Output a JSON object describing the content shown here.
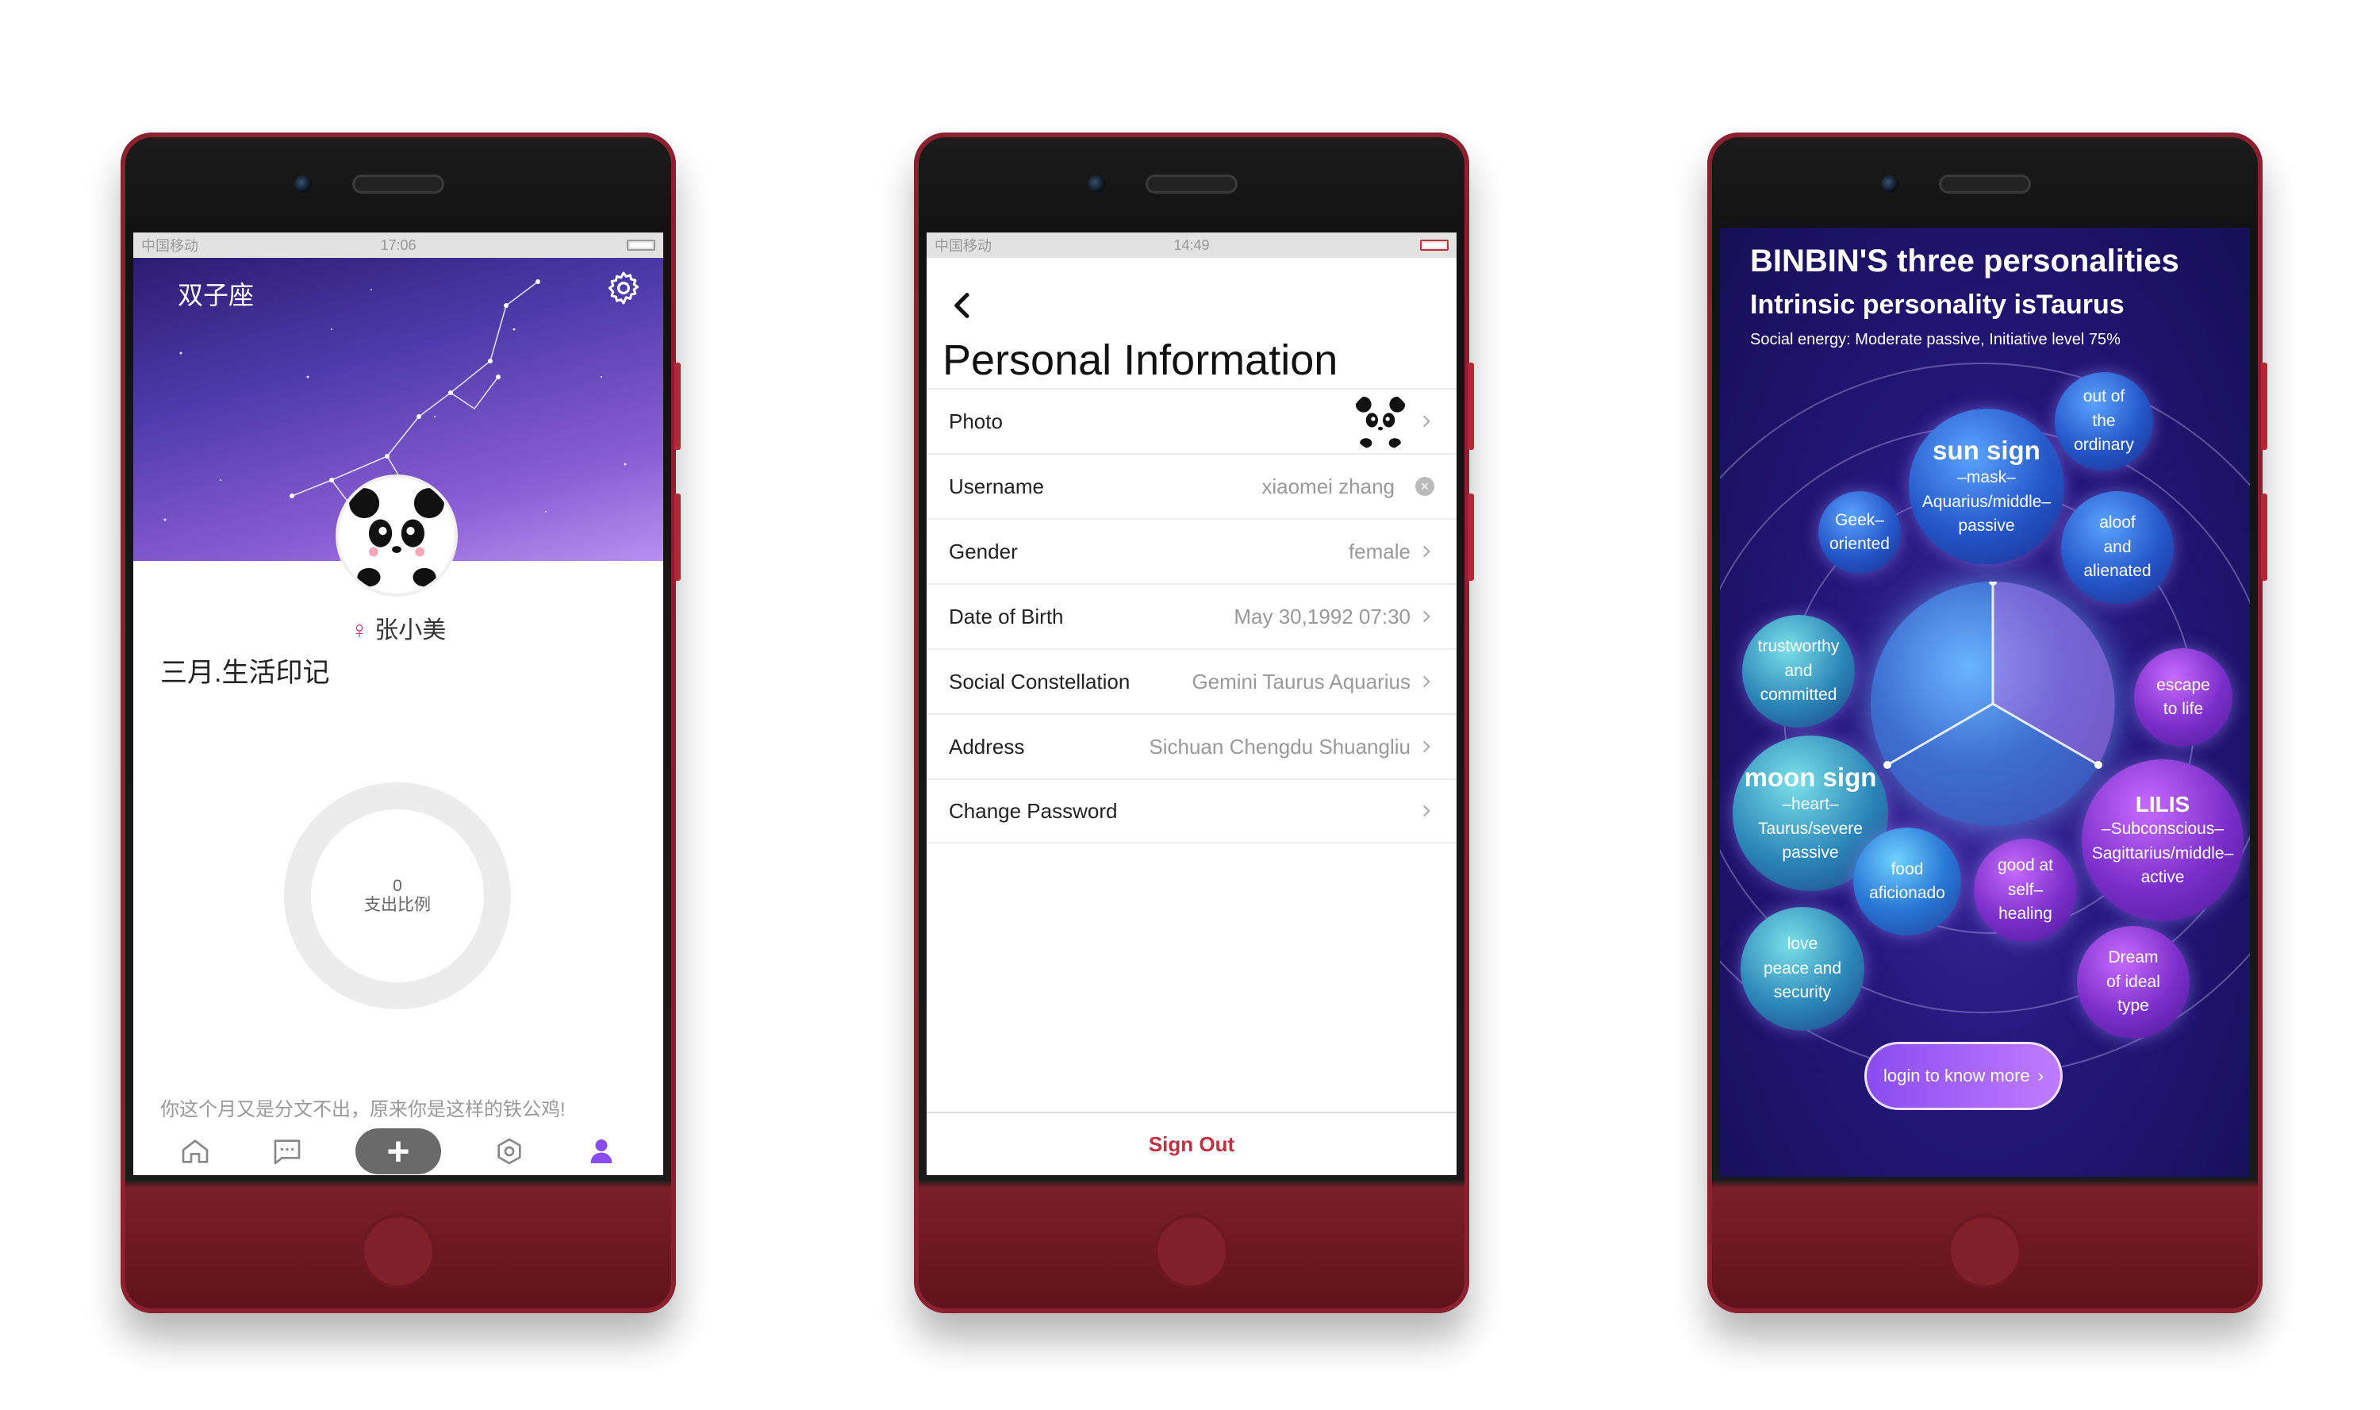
{
  "phone1": {
    "status": {
      "carrier": "中国移动",
      "time": "17:06"
    },
    "header_title": "双子座",
    "username": "张小美",
    "section_title": "三月.生活印记",
    "ring": {
      "value": "0",
      "label": "支出比例"
    },
    "tip": "你这个月又是分文不出，原来你是这样的铁公鸡!",
    "tabs": [
      "home-icon",
      "message-icon",
      "plus-icon",
      "hexagon-icon",
      "user-icon"
    ],
    "colors": {
      "accent": "#8a4cf0",
      "female": "#e0306f"
    }
  },
  "phone2": {
    "status": {
      "carrier": "中国移动",
      "time": "14:49"
    },
    "title": "Personal Information",
    "rows": [
      {
        "label": "Photo",
        "value": ""
      },
      {
        "label": "Username",
        "value": "xiaomei zhang"
      },
      {
        "label": "Gender",
        "value": "female"
      },
      {
        "label": "Date of Birth",
        "value": "May 30,1992 07:30"
      },
      {
        "label": "Social Constellation",
        "value": "Gemini Taurus Aquarius"
      },
      {
        "label": "Address",
        "value": "Sichuan Chengdu Shuangliu"
      },
      {
        "label": "Change Password",
        "value": ""
      }
    ],
    "sign_out": "Sign Out",
    "colors": {
      "sign_out": "#c03040"
    }
  },
  "phone3": {
    "title": "BINBIN'S three personalities",
    "subtitle": "Intrinsic personality isTaurus",
    "energy": "Social energy:   Moderate passive, Initiative level 75%",
    "sun": {
      "title": "sun sign",
      "lines": [
        "–mask–",
        "Aquarius/middle–",
        "passive"
      ]
    },
    "moon": {
      "title": "moon sign",
      "lines": [
        "–heart–",
        "Taurus/severe",
        "passive"
      ]
    },
    "lilis": {
      "title": "LILIS",
      "lines": [
        "–Subconscious–",
        "Sagittarius/middle–",
        "active"
      ]
    },
    "traits": [
      {
        "l1": "out of",
        "l2": "the",
        "l3": "ordinary"
      },
      {
        "l1": "Geek–",
        "l2": "oriented",
        "l3": ""
      },
      {
        "l1": "aloof",
        "l2": "and",
        "l3": "alienated"
      },
      {
        "l1": "trustworthy",
        "l2": "and",
        "l3": "committed"
      },
      {
        "l1": "escape",
        "l2": "to life",
        "l3": ""
      },
      {
        "l1": "food",
        "l2": "aficionado",
        "l3": ""
      },
      {
        "l1": "good at",
        "l2": "self–",
        "l3": "healing"
      },
      {
        "l1": "love",
        "l2": "peace and",
        "l3": "security"
      },
      {
        "l1": "Dream",
        "l2": "of ideal",
        "l3": "type"
      }
    ],
    "login": "login to know more"
  }
}
